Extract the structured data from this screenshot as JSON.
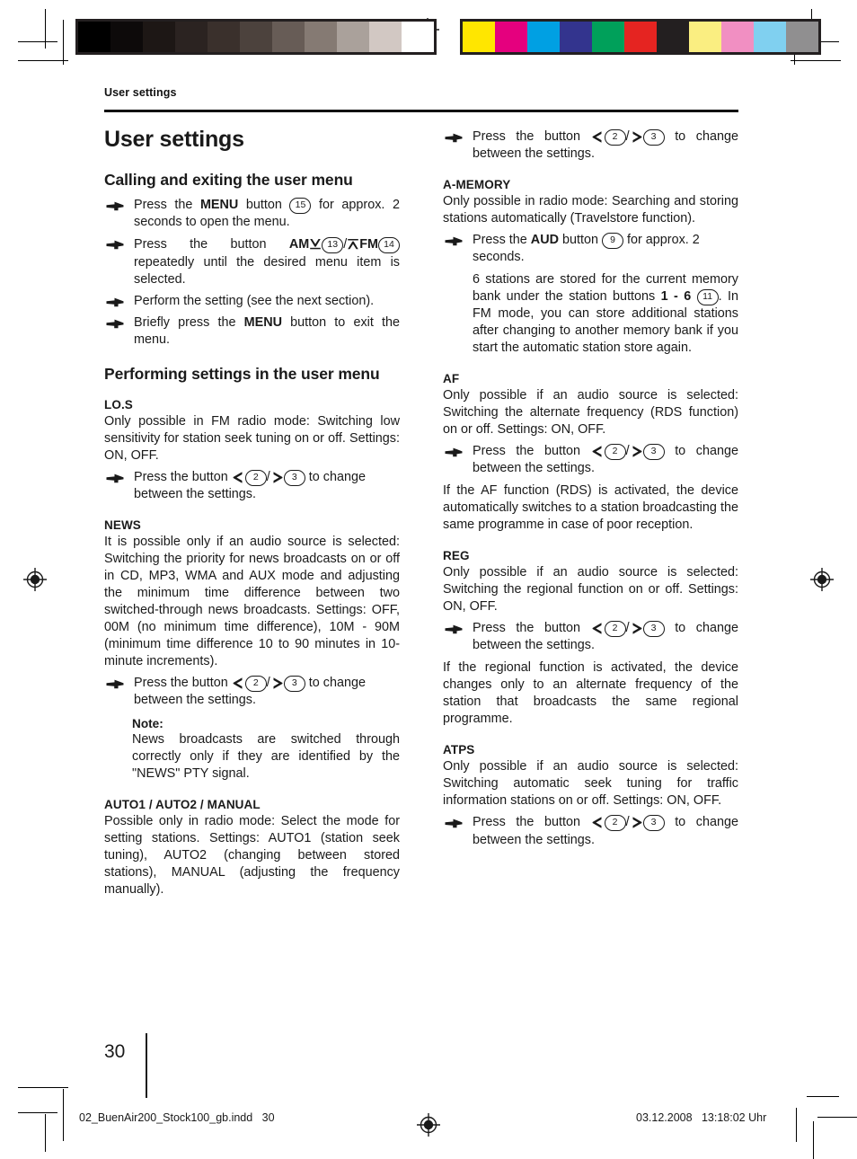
{
  "document": {
    "running_head": "User settings",
    "page_number": "30",
    "footer_filename": "02_BuenAir200_Stock100_gb.indd   30",
    "footer_datetime": "03.12.2008   13:18:02 Uhr"
  },
  "colorbars": {
    "grayscale": [
      "#000000",
      "#0d0a0a",
      "#1d1715",
      "#2b2321",
      "#3a302c",
      "#4c423d",
      "#675c56",
      "#857a73",
      "#aaa19b",
      "#d2c8c3",
      "#ffffff"
    ],
    "process": [
      "#ffe600",
      "#e5007e",
      "#00a0e3",
      "#33348e",
      "#00a05a",
      "#e52421",
      "#231f20",
      "#faee81",
      "#f18fc2",
      "#80d0f0",
      "#908f90"
    ]
  },
  "left_column": {
    "title": "User settings",
    "section_1": {
      "heading": "Calling and exiting the user menu",
      "steps": [
        {
          "parts": [
            {
              "t": "text",
              "v": "Press the "
            },
            {
              "t": "bold",
              "v": "MENU"
            },
            {
              "t": "text",
              "v": " button "
            },
            {
              "t": "ref",
              "v": "15"
            },
            {
              "t": "text",
              "v": " for approx. 2 seconds to open the menu."
            }
          ]
        },
        {
          "parts": [
            {
              "t": "text",
              "v": "Press the button "
            },
            {
              "t": "bold",
              "v": "AM"
            },
            {
              "t": "glyph-down",
              "v": "⌄"
            },
            {
              "t": "ref",
              "v": "13"
            },
            {
              "t": "text",
              "v": "/"
            },
            {
              "t": "glyph-up",
              "v": "⌃"
            },
            {
              "t": "bold",
              "v": "FM"
            },
            {
              "t": "ref",
              "v": "14"
            },
            {
              "t": "text",
              "v": " repeatedly until the desired menu item is selected."
            }
          ]
        },
        {
          "parts": [
            {
              "t": "text",
              "v": "Perform the setting (see the next section)."
            }
          ]
        },
        {
          "parts": [
            {
              "t": "text",
              "v": "Briefly press the "
            },
            {
              "t": "bold",
              "v": "MENU"
            },
            {
              "t": "text",
              "v": " button to exit the menu."
            }
          ]
        }
      ]
    },
    "section_2": {
      "heading": "Performing settings in the user menu",
      "entries": [
        {
          "title": "LO.S",
          "body": "Only possible in FM radio mode: Switching low sensitivity for station seek tuning on or off. Settings: ON, OFF.",
          "step_prefix": "Press the button ",
          "step_ref_left": "2",
          "step_ref_right": "3",
          "step_suffix": " to change between the settings."
        },
        {
          "title": "NEWS",
          "body": "It is possible only if an audio source is selected: Switching the priority for news broadcasts on or off in CD, MP3, WMA and AUX mode and adjusting the minimum time difference between two switched-through news broadcasts. Settings: OFF, 00M (no minimum time difference), 10M - 90M (minimum time difference 10 to 90 minutes in 10-minute increments).",
          "step_prefix": "Press the button ",
          "step_ref_left": "2",
          "step_ref_right": "3",
          "step_suffix": " to change between the settings.",
          "note_title": "Note:",
          "note_body": "News broadcasts are switched through correctly only if they are identified by the \"NEWS\" PTY signal."
        },
        {
          "title": "AUTO1 / AUTO2 / MANUAL",
          "body": "Possible only in radio mode: Select the mode for setting stations. Settings: AUTO1 (station seek tuning), AUTO2 (changing between stored stations), MANUAL (adjusting the frequency manually)."
        }
      ]
    }
  },
  "right_column": {
    "lead_step": {
      "prefix": "Press the button ",
      "ref_left": "2",
      "ref_right": "3",
      "suffix": " to change between the settings."
    },
    "entries": [
      {
        "title": "A-MEMORY",
        "body": "Only possible in radio mode: Searching and storing stations automatically (Travelstore function).",
        "step_parts": [
          {
            "t": "text",
            "v": "Press the "
          },
          {
            "t": "bold",
            "v": "AUD"
          },
          {
            "t": "text",
            "v": " button "
          },
          {
            "t": "ref",
            "v": "9"
          },
          {
            "t": "text",
            "v": " for approx. 2 seconds."
          }
        ],
        "indented_parts": [
          {
            "t": "text",
            "v": "6 stations are stored for the current memory bank under the station buttons "
          },
          {
            "t": "bold",
            "v": "1 - 6"
          },
          {
            "t": "text",
            "v": " "
          },
          {
            "t": "ref",
            "v": "11"
          },
          {
            "t": "text",
            "v": ". In FM mode, you can store additional stations after changing to another memory bank if you start the automatic station store again."
          }
        ]
      },
      {
        "title": "AF",
        "body": "Only possible if an audio source is selected: Switching the alternate frequency (RDS function) on or off. Settings: ON, OFF.",
        "step_prefix": "Press the button ",
        "step_ref_left": "2",
        "step_ref_right": "3",
        "step_suffix": " to change between the settings.",
        "trailing": "If the AF function (RDS) is activated, the device automatically switches to a station broadcasting the same programme in case of poor reception."
      },
      {
        "title": "REG",
        "body": "Only possible if an audio source is selected: Switching the regional function on or off. Settings: ON, OFF.",
        "step_prefix": "Press the button ",
        "step_ref_left": "2",
        "step_ref_right": "3",
        "step_suffix": " to change between the settings.",
        "trailing": "If the regional function is activated, the device changes only to an alternate frequency of the station that broadcasts the same regional programme."
      },
      {
        "title": "ATPS",
        "body": "Only possible if an audio source is selected: Switching automatic seek tuning for traffic information stations on or off. Settings: ON, OFF.",
        "step_prefix": "Press the button ",
        "step_ref_left": "2",
        "step_ref_right": "3",
        "step_suffix": " to change between the settings."
      }
    ]
  }
}
